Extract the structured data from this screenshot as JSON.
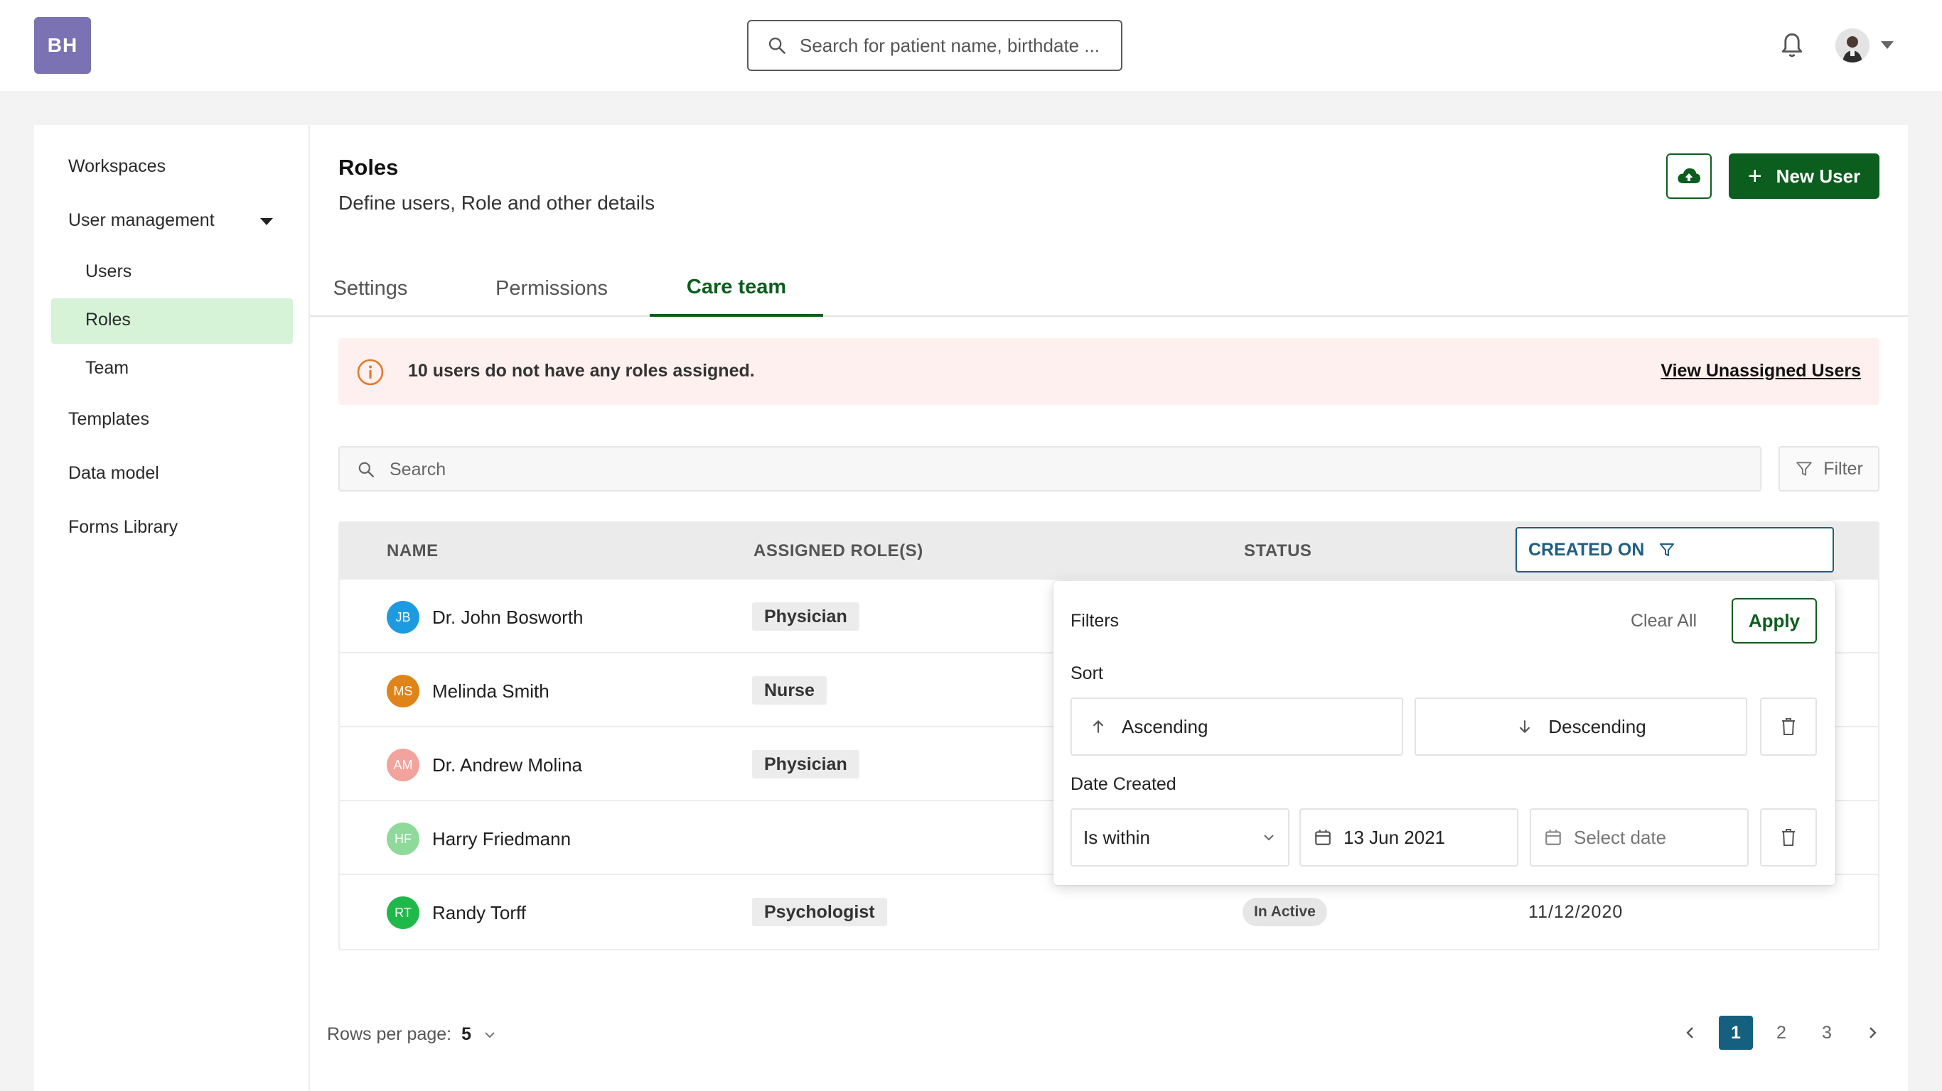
{
  "app": {
    "logo_text": "BH",
    "search_placeholder": "Search for patient name, birthdate ..."
  },
  "sidebar": {
    "items": [
      {
        "label": "Workspaces"
      },
      {
        "label": "User management"
      },
      {
        "label": "Users"
      },
      {
        "label": "Roles",
        "active": true
      },
      {
        "label": "Team"
      },
      {
        "label": "Templates"
      },
      {
        "label": "Data model"
      },
      {
        "label": "Forms Library"
      }
    ]
  },
  "page": {
    "title": "Roles",
    "subtitle": "Define users, Role and other details",
    "new_user_label": "New User",
    "tabs": [
      {
        "label": "Settings"
      },
      {
        "label": "Permissions"
      },
      {
        "label": "Care team",
        "active": true
      }
    ]
  },
  "alert": {
    "message": "10 users do not have any roles assigned.",
    "link": "View Unassigned Users"
  },
  "table": {
    "search_placeholder": "Search",
    "filter_label": "Filter",
    "columns": [
      "NAME",
      "ASSIGNED ROLE(S)",
      "STATUS",
      "CREATED ON"
    ],
    "rows": [
      {
        "initials": "JB",
        "name": "Dr. John Bosworth",
        "role": "Physician",
        "status": "",
        "created": "",
        "avatar_color": "#1e9be0"
      },
      {
        "initials": "MS",
        "name": "Melinda Smith",
        "role": "Nurse",
        "status": "",
        "created": "",
        "avatar_color": "#e0841a"
      },
      {
        "initials": "AM",
        "name": "Dr. Andrew Molina",
        "role": "Physician",
        "status": "",
        "created": "",
        "avatar_color": "#f2a39c"
      },
      {
        "initials": "HF",
        "name": "Harry Friedmann",
        "role": "",
        "status": "",
        "created": "",
        "avatar_color": "#8fd99a"
      },
      {
        "initials": "RT",
        "name": "Randy Torff",
        "role": "Psychologist",
        "status": "In Active",
        "created": "11/12/2020",
        "avatar_color": "#1fb94a"
      }
    ]
  },
  "filter_popover": {
    "title": "Filters",
    "clear_all": "Clear All",
    "apply": "Apply",
    "sort_label": "Sort",
    "ascending": "Ascending",
    "descending": "Descending",
    "date_created_label": "Date Created",
    "condition": "Is within",
    "start_date": "13 Jun 2021",
    "end_date_placeholder": "Select date"
  },
  "pagination": {
    "rows_per_page_label": "Rows per page:",
    "rows_per_page": "5",
    "pages": [
      "1",
      "2",
      "3"
    ],
    "current_page": "1"
  },
  "colors": {
    "brand_green": "#0b5e1d",
    "active_nav_bg": "#d6f3d8",
    "accent_blue": "#15607f",
    "logo_bg": "#7b72b3",
    "alert_bg": "#fdf0ee"
  }
}
